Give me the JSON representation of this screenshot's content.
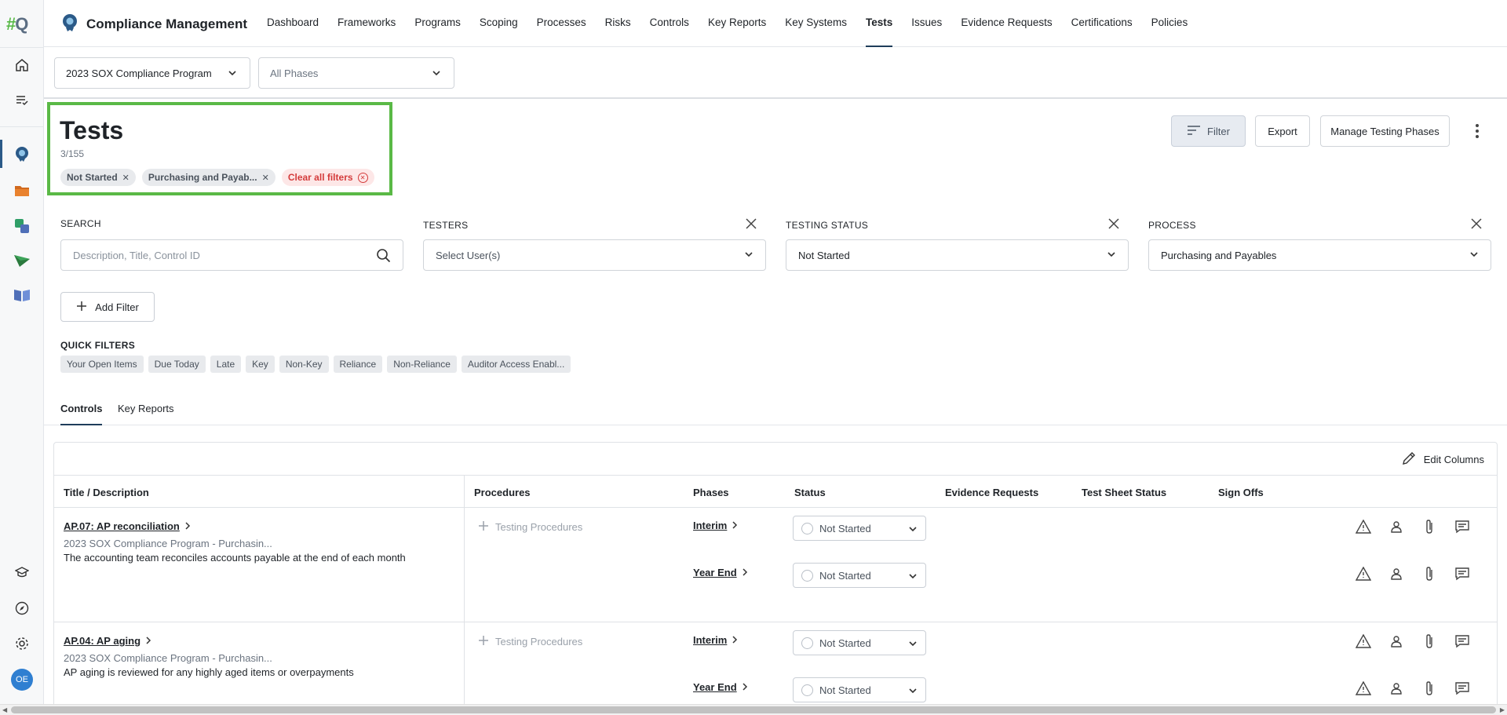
{
  "app": {
    "logo_text": "#Q",
    "title": "Compliance Management",
    "user_initials": "OE"
  },
  "nav": {
    "items": [
      "Dashboard",
      "Frameworks",
      "Programs",
      "Scoping",
      "Processes",
      "Risks",
      "Controls",
      "Key Reports",
      "Key Systems",
      "Tests",
      "Issues",
      "Evidence Requests",
      "Certifications",
      "Policies"
    ],
    "active": "Tests"
  },
  "selectors": {
    "program": "2023 SOX Compliance Program",
    "phase_placeholder": "All Phases"
  },
  "header": {
    "title": "Tests",
    "count": "3/155",
    "chips": [
      "Not Started",
      "Purchasing and Payab...",
      "Clear all filters"
    ]
  },
  "actions": {
    "filter": "Filter",
    "export": "Export",
    "manage_phases": "Manage Testing Phases"
  },
  "filters": {
    "search": {
      "label": "SEARCH",
      "placeholder": "Description, Title, Control ID"
    },
    "testers": {
      "label": "TESTERS",
      "placeholder": "Select User(s)"
    },
    "testing_status": {
      "label": "TESTING STATUS",
      "value": "Not Started"
    },
    "process": {
      "label": "PROCESS",
      "value": "Purchasing and Payables"
    },
    "add_filter": "Add Filter"
  },
  "quick_filters": {
    "label": "QUICK FILTERS",
    "items": [
      "Your Open Items",
      "Due Today",
      "Late",
      "Key",
      "Non-Key",
      "Reliance",
      "Non-Reliance",
      "Auditor Access Enabl..."
    ]
  },
  "tabs": [
    "Controls",
    "Key Reports"
  ],
  "table": {
    "edit_columns": "Edit Columns",
    "columns": [
      "Title / Description",
      "Procedures",
      "Phases",
      "Status",
      "Evidence Requests",
      "Test Sheet Status",
      "Sign Offs"
    ],
    "rows": [
      {
        "title": "AP.07: AP reconciliation",
        "program": "2023 SOX Compliance Program - Purchasin...",
        "description": "The accounting team reconciles accounts payable at the end of each month",
        "procedures": "Testing Procedures",
        "phases": [
          {
            "name": "Interim",
            "status": "Not Started"
          },
          {
            "name": "Year End",
            "status": "Not Started"
          }
        ]
      },
      {
        "title": "AP.04: AP aging",
        "program": "2023 SOX Compliance Program - Purchasin...",
        "description": "AP aging is reviewed for any highly aged items or overpayments",
        "procedures": "Testing Procedures",
        "phases": [
          {
            "name": "Interim",
            "status": "Not Started"
          },
          {
            "name": "Year End",
            "status": "Not Started"
          }
        ]
      }
    ]
  }
}
